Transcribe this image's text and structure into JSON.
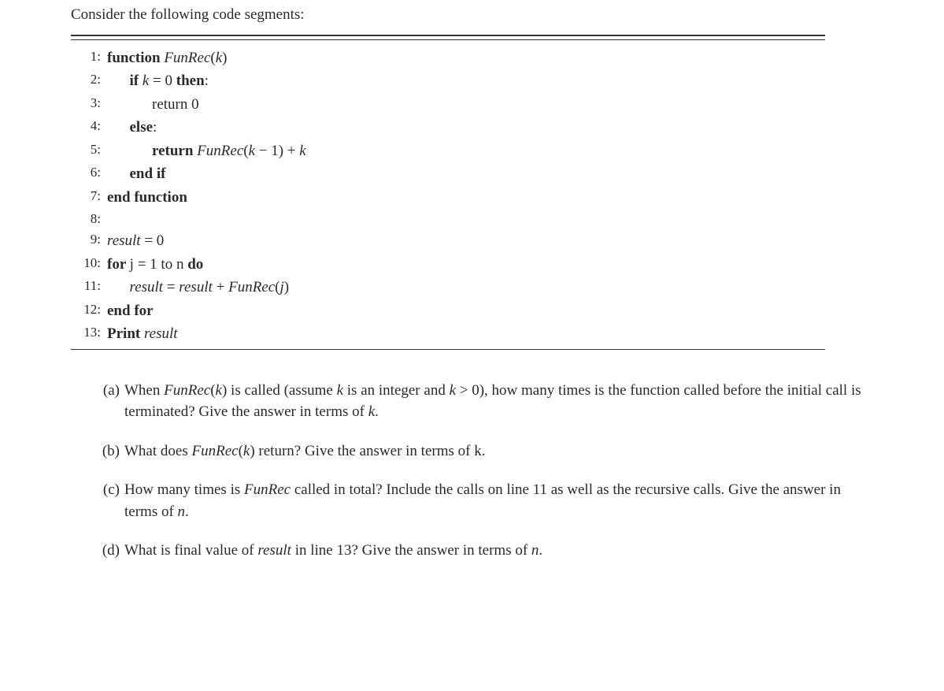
{
  "intro": "Consider the following code segments:",
  "alg": {
    "lines": [
      {
        "n": "1:",
        "indent": 0,
        "segs": [
          {
            "t": "function ",
            "b": true
          },
          {
            "t": "FunRec",
            "i": true
          },
          {
            "t": "("
          },
          {
            "t": "k",
            "i": true
          },
          {
            "t": ")"
          }
        ]
      },
      {
        "n": "2:",
        "indent": 1,
        "segs": [
          {
            "t": "if ",
            "b": true
          },
          {
            "t": "k",
            "i": true
          },
          {
            "t": " = 0 "
          },
          {
            "t": "then",
            "b": true
          },
          {
            "t": ":"
          }
        ]
      },
      {
        "n": "3:",
        "indent": 2,
        "segs": [
          {
            "t": "return 0"
          }
        ]
      },
      {
        "n": "4:",
        "indent": 1,
        "segs": [
          {
            "t": "else",
            "b": true
          },
          {
            "t": ":"
          }
        ]
      },
      {
        "n": "5:",
        "indent": 2,
        "segs": [
          {
            "t": "return ",
            "b": true
          },
          {
            "t": "FunRec",
            "i": true
          },
          {
            "t": "("
          },
          {
            "t": "k",
            "i": true
          },
          {
            "t": " − 1) + "
          },
          {
            "t": "k",
            "i": true
          }
        ]
      },
      {
        "n": "6:",
        "indent": 1,
        "segs": [
          {
            "t": "end if",
            "b": true
          }
        ]
      },
      {
        "n": "7:",
        "indent": 0,
        "segs": [
          {
            "t": "end function",
            "b": true
          }
        ]
      },
      {
        "n": "8:",
        "indent": 0,
        "segs": []
      },
      {
        "n": "9:",
        "indent": 0,
        "segs": [
          {
            "t": "result",
            "i": true
          },
          {
            "t": " = 0"
          }
        ]
      },
      {
        "n": "10:",
        "indent": 0,
        "segs": [
          {
            "t": "for ",
            "b": true
          },
          {
            "t": "j = 1 to n "
          },
          {
            "t": "do",
            "b": true
          }
        ]
      },
      {
        "n": "11:",
        "indent": 1,
        "segs": [
          {
            "t": "result",
            "i": true
          },
          {
            "t": " = "
          },
          {
            "t": "result",
            "i": true
          },
          {
            "t": " + "
          },
          {
            "t": "FunRec",
            "i": true
          },
          {
            "t": "("
          },
          {
            "t": "j",
            "i": true
          },
          {
            "t": ")"
          }
        ]
      },
      {
        "n": "12:",
        "indent": 0,
        "segs": [
          {
            "t": "end for",
            "b": true
          }
        ]
      },
      {
        "n": "13:",
        "indent": 0,
        "segs": [
          {
            "t": "Print ",
            "b": true
          },
          {
            "t": "result",
            "i": true
          }
        ]
      }
    ]
  },
  "questions": [
    {
      "label": "(a)",
      "segs": [
        {
          "t": "When "
        },
        {
          "t": "FunRec",
          "i": true
        },
        {
          "t": "("
        },
        {
          "t": "k",
          "i": true
        },
        {
          "t": ") is called (assume "
        },
        {
          "t": "k",
          "i": true
        },
        {
          "t": " is an integer and "
        },
        {
          "t": "k",
          "i": true
        },
        {
          "t": " > 0), how many times is the function called before the initial call is terminated? Give the answer in terms of "
        },
        {
          "t": "k",
          "i": true
        },
        {
          "t": "."
        }
      ]
    },
    {
      "label": "(b)",
      "segs": [
        {
          "t": "What does "
        },
        {
          "t": "FunRec",
          "i": true
        },
        {
          "t": "("
        },
        {
          "t": "k",
          "i": true
        },
        {
          "t": ") return? Give the answer in terms of k."
        }
      ]
    },
    {
      "label": "(c)",
      "segs": [
        {
          "t": "How many times is "
        },
        {
          "t": "FunRec",
          "i": true
        },
        {
          "t": " called in total? Include the calls on line 11 as well as the recursive calls. Give the answer in terms of "
        },
        {
          "t": "n",
          "i": true
        },
        {
          "t": "."
        }
      ]
    },
    {
      "label": "(d)",
      "segs": [
        {
          "t": "What is final value of "
        },
        {
          "t": "result",
          "i": true
        },
        {
          "t": " in line 13? Give the answer in terms of "
        },
        {
          "t": "n",
          "i": true
        },
        {
          "t": "."
        }
      ]
    }
  ]
}
